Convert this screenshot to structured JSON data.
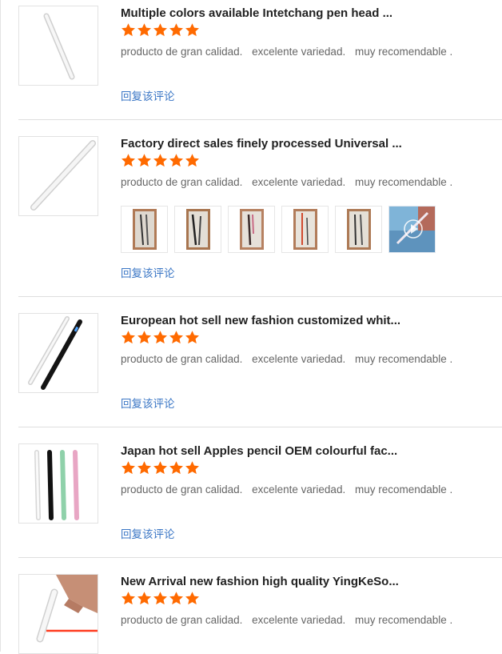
{
  "colors": {
    "star": "#ff6a00",
    "link": "#3a76c5",
    "divider": "#dedede"
  },
  "reviews": [
    {
      "title": "Multiple colors available Intetchang pen head ...",
      "rating": 5,
      "comment": [
        "producto de gran calidad.",
        "excelente variedad.",
        "muy recomendable ."
      ],
      "reply": "回复该评论"
    },
    {
      "title": "Factory direct sales finely processed Universal ...",
      "rating": 5,
      "comment": [
        "producto de gran calidad.",
        "excelente variedad.",
        "muy recomendable ."
      ],
      "reply": "回复该评论",
      "photos": [
        "photo-1",
        "photo-2",
        "photo-3",
        "photo-4",
        "photo-5",
        "video-thumbnail"
      ]
    },
    {
      "title": "European hot sell new fashion customized whit...",
      "rating": 5,
      "comment": [
        "producto de gran calidad.",
        "excelente variedad.",
        "muy recomendable ."
      ],
      "reply": "回复该评论"
    },
    {
      "title": "Japan hot sell Apples pencil OEM colourful fac...",
      "rating": 5,
      "comment": [
        "producto de gran calidad.",
        "excelente variedad.",
        "muy recomendable ."
      ],
      "reply": "回复该评论"
    },
    {
      "title": "New Arrival new fashion high quality YingKeSo...",
      "rating": 5,
      "comment": [
        "producto de gran calidad.",
        "excelente variedad.",
        "muy recomendable ."
      ]
    }
  ]
}
